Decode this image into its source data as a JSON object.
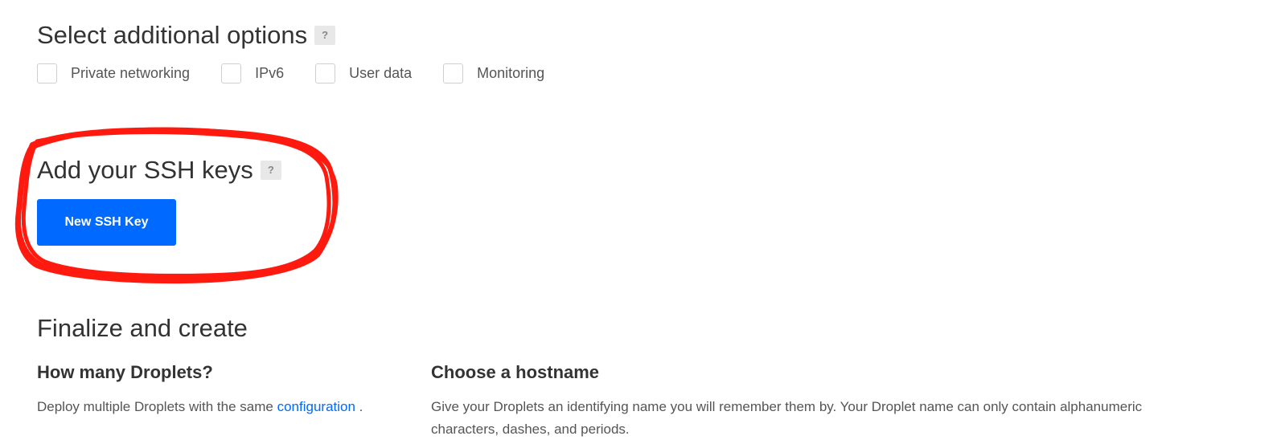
{
  "options": {
    "title": "Select additional options",
    "help_label": "?",
    "items": [
      {
        "label": "Private networking",
        "checked": false
      },
      {
        "label": "IPv6",
        "checked": false
      },
      {
        "label": "User data",
        "checked": false
      },
      {
        "label": "Monitoring",
        "checked": false
      }
    ]
  },
  "ssh": {
    "title": "Add your SSH keys",
    "help_label": "?",
    "button_label": "New SSH Key",
    "annotation_color": "#ff1a0f"
  },
  "finalize": {
    "title": "Finalize and create",
    "droplets": {
      "title": "How many Droplets?",
      "desc_before": "Deploy multiple Droplets with the same",
      "link": "configuration",
      "desc_after": "."
    },
    "hostname": {
      "title": "Choose a hostname",
      "desc": "Give your Droplets an identifying name you will remember them by. Your Droplet name can only contain alphanumeric characters, dashes, and periods."
    }
  },
  "colors": {
    "primary": "#0069ff",
    "heading": "#333333",
    "body_text": "#555555"
  }
}
